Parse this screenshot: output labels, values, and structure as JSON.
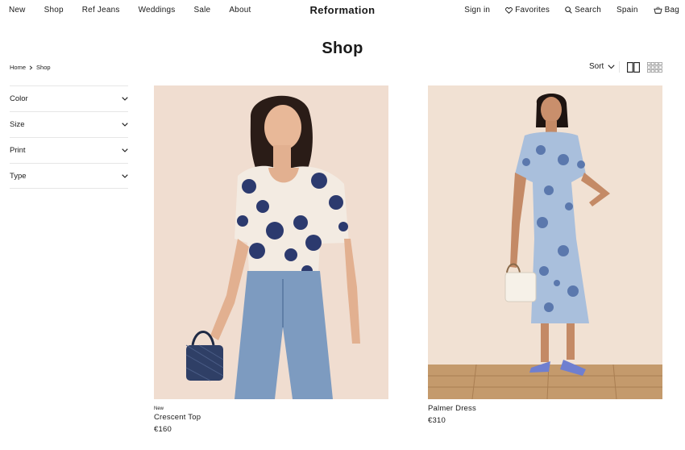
{
  "header": {
    "nav_left": [
      "New",
      "Shop",
      "Ref Jeans",
      "Weddings",
      "Sale",
      "About"
    ],
    "logo": "Reformation",
    "sign_in": "Sign in",
    "favorites": "Favorites",
    "search": "Search",
    "region": "Spain",
    "bag": "Bag"
  },
  "page": {
    "title": "Shop",
    "breadcrumb": [
      "Home",
      "Shop"
    ],
    "sort_label": "Sort"
  },
  "filters": [
    "Color",
    "Size",
    "Print",
    "Type"
  ],
  "products": [
    {
      "badge": "New",
      "name": "Crescent Top",
      "price": "€160"
    },
    {
      "badge": "",
      "name": "Palmer Dress",
      "price": "€310"
    }
  ],
  "colors": {
    "text": "#1a1a1a",
    "divider": "#e6e6e6",
    "photo_background": "#f0ddd0",
    "floor": "#c49a6c",
    "print_navy": "#2c3a6e",
    "denim": "#7d9bc0"
  }
}
